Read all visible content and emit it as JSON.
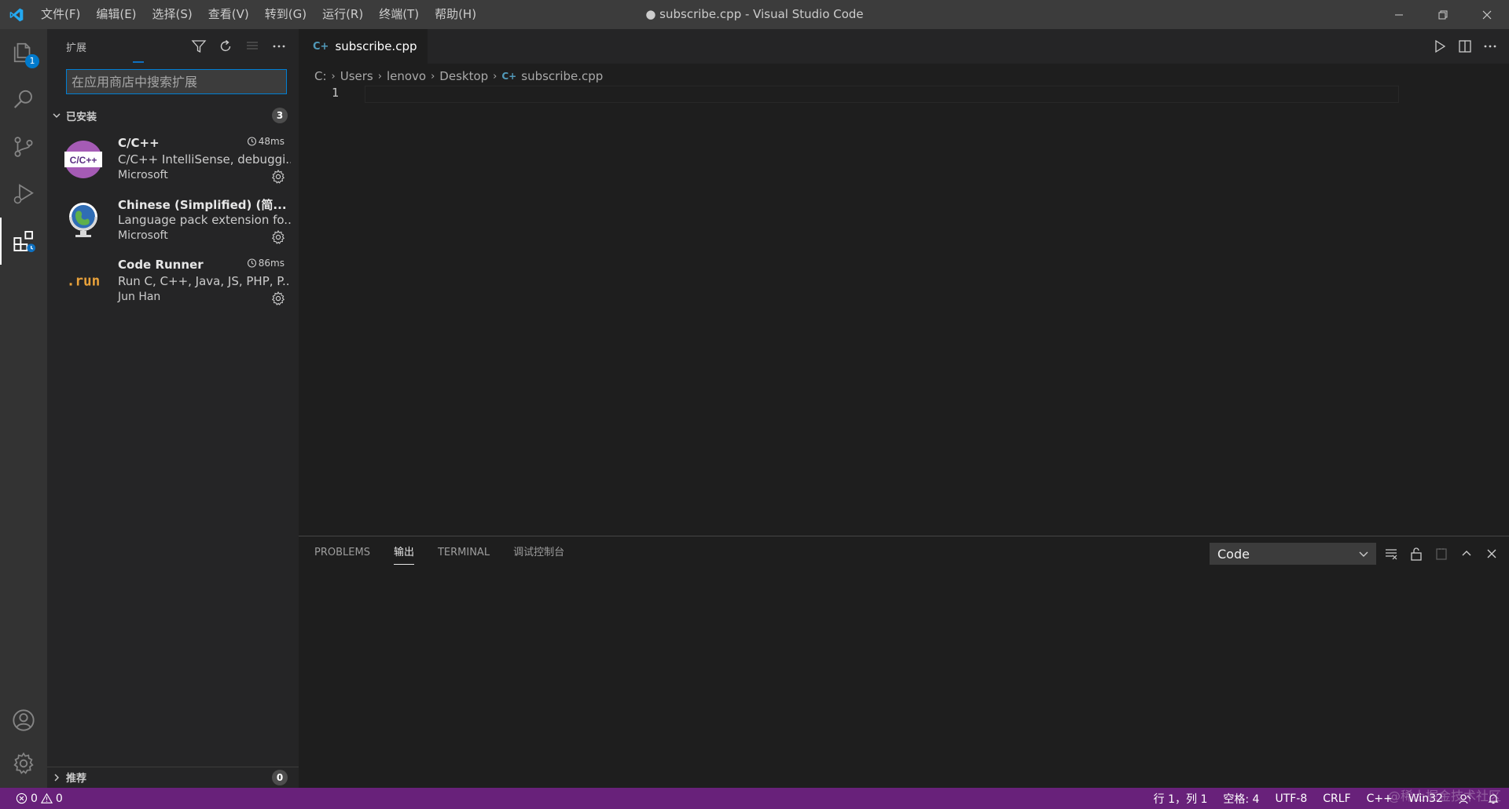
{
  "window": {
    "title": "● subscribe.cpp - Visual Studio Code",
    "menu": [
      "文件(F)",
      "编辑(E)",
      "选择(S)",
      "查看(V)",
      "转到(G)",
      "运行(R)",
      "终端(T)",
      "帮助(H)"
    ]
  },
  "activity": {
    "explorer_badge": "1"
  },
  "sidebar": {
    "title": "扩展",
    "search_placeholder": "在应用商店中搜索扩展",
    "installed_label": "已安装",
    "installed_count": "3",
    "extensions": [
      {
        "name": "C/C++",
        "description": "C/C++ IntelliSense, debuggi...",
        "publisher": "Microsoft",
        "time": "48ms",
        "icon": "cpp-icon",
        "icon_text": "C/C++"
      },
      {
        "name": "Chinese (Simplified) (简...",
        "description": "Language pack extension fo...",
        "publisher": "Microsoft",
        "time": "",
        "icon": "globe-icon"
      },
      {
        "name": "Code Runner",
        "description": "Run C, C++, Java, JS, PHP, P...",
        "publisher": "Jun Han",
        "time": "86ms",
        "icon": "run-icon",
        "icon_text": ".run"
      }
    ],
    "recommended_label": "推荐",
    "recommended_count": "0"
  },
  "editor": {
    "tab_label": "subscribe.cpp",
    "breadcrumbs": [
      "C:",
      "Users",
      "lenovo",
      "Desktop",
      "subscribe.cpp"
    ],
    "line_number": "1"
  },
  "panel": {
    "tabs": [
      "PROBLEMS",
      "输出",
      "TERMINAL",
      "调试控制台"
    ],
    "active_tab": "输出",
    "output_channel": "Code"
  },
  "statusbar": {
    "errors": "0",
    "warnings": "0",
    "position": "行 1，列 1",
    "spaces": "空格: 4",
    "encoding": "UTF-8",
    "eol": "CRLF",
    "language": "C++",
    "platform": "Win32"
  },
  "watermark": "@稀土掘金技术社区",
  "colors": {
    "statusbar": "#68217a",
    "accent": "#007acc"
  }
}
